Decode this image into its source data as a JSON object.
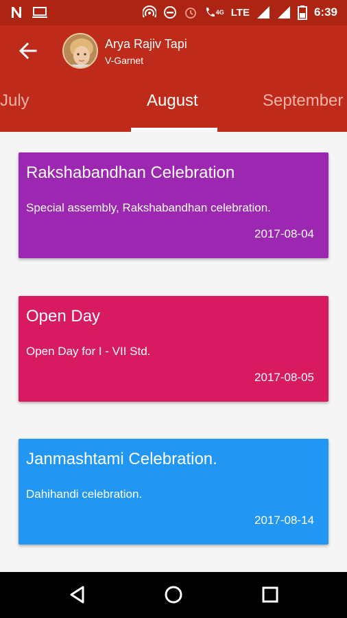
{
  "status_bar": {
    "time": "6:39",
    "network": "LTE",
    "network_small": "4G",
    "icons_left": [
      "n-notification-icon",
      "laptop-icon"
    ],
    "icons_right": [
      "hotspot-icon",
      "dnd-icon",
      "alarm-icon",
      "call-icon",
      "signal-icon",
      "signal-icon",
      "battery-icon"
    ]
  },
  "header": {
    "name": "Arya Rajiv Tapi",
    "class": "V-Garnet",
    "back_icon": "arrow-back-icon"
  },
  "tabs": [
    {
      "label": "July",
      "active": false
    },
    {
      "label": "August",
      "active": true
    },
    {
      "label": "September",
      "active": false
    }
  ],
  "events": [
    {
      "title": "Rakshabandhan Celebration",
      "description": "Special assembly, Rakshabandhan celebration.",
      "date": "2017-08-04",
      "color": "#9c27b0"
    },
    {
      "title": "Open Day",
      "description": "Open Day for I - VII Std.",
      "date": "2017-08-05",
      "color": "#d81b60"
    },
    {
      "title": "Janmashtami Celebration.",
      "description": "Dahihandi celebration.",
      "date": "2017-08-14",
      "color": "#2196f3"
    }
  ],
  "colors": {
    "status_bar": "#ad2512",
    "app_bar": "#bf2b1a",
    "background": "#f5f5f5"
  },
  "nav_bar": {
    "icons": [
      "back-triangle-icon",
      "home-circle-icon",
      "recents-square-icon"
    ]
  }
}
